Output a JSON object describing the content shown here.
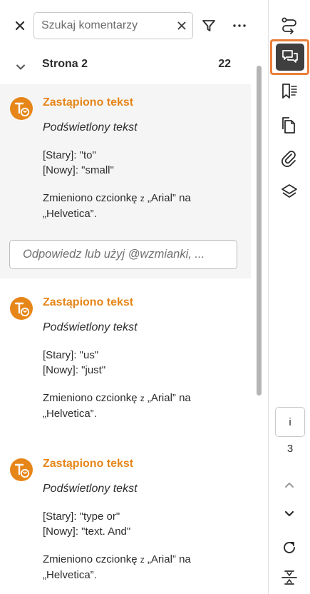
{
  "search": {
    "placeholder": "Szukaj komentarzy"
  },
  "group": {
    "title": "Strona 2",
    "count": "22"
  },
  "comments": [
    {
      "title": "Zastąpiono tekst",
      "highlight": "Podświetlony tekst",
      "old_line": "[Stary]: \"to\"",
      "new_line": "[Nowy]: \"small\"",
      "font_prefix": "Zmieniono czcionkę",
      "font_z": "z",
      "font_from": "„Arial” na",
      "font_to": "„Helvetica”."
    },
    {
      "title": "Zastąpiono tekst",
      "highlight": "Podświetlony tekst",
      "old_line": "[Stary]: \"us\"",
      "new_line": "[Nowy]: \"just\"",
      "font_prefix": "Zmieniono czcionkę",
      "font_z": "z",
      "font_from": "„Arial” na",
      "font_to": "„Helvetica”."
    },
    {
      "title": "Zastąpiono tekst",
      "highlight": "Podświetlony tekst",
      "old_line": "[Stary]: \"type or\"",
      "new_line": "[Nowy]: \"text.  And\"",
      "font_prefix": "Zmieniono czcionkę",
      "font_z": "z",
      "font_from": "„Arial” na",
      "font_to": "„Helvetica”."
    }
  ],
  "reply": {
    "placeholder": "Odpowiedz lub użyj @wzmianki, ..."
  },
  "pager": {
    "current": "i",
    "total": "3"
  },
  "colors": {
    "accent_orange": "#e68619",
    "active_border": "#ea7f3c",
    "active_fill": "#3f3f3f"
  },
  "rail_icons": [
    "compare-icon",
    "comments-icon",
    "bookmarks-icon",
    "pages-icon",
    "attachments-icon",
    "layers-icon"
  ]
}
